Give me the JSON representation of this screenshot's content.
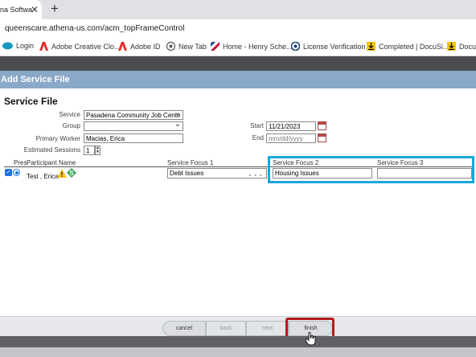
{
  "browser": {
    "tab_title": "na Softwa",
    "url": "queenscare.athena-us.com/acm_topFrameControl",
    "bookmarks": [
      {
        "label": "Login",
        "icon": "salesforce-icon",
        "color": "#1798c1"
      },
      {
        "label": "Adobe Creative Clo...",
        "icon": "adobe-icon",
        "color": "#e22b26"
      },
      {
        "label": "Adobe ID",
        "icon": "adobe-icon",
        "color": "#e22b26"
      },
      {
        "label": "New Tab",
        "icon": "globe-icon",
        "color": "#555555"
      },
      {
        "label": "Home - Henry Sche...",
        "icon": "henry-schein-icon",
        "color": "#c8102e"
      },
      {
        "label": "License Verification",
        "icon": "license-icon",
        "color": "#1a3b7a"
      },
      {
        "label": "Completed | DocuSi...",
        "icon": "docusign-icon",
        "color": "#f6c700"
      },
      {
        "label": "DocuSi",
        "icon": "docusign-icon",
        "color": "#f6c700"
      }
    ]
  },
  "dialog": {
    "window_title": "Add Service File",
    "heading": "Service File",
    "form": {
      "service_label": "Service",
      "service_value": "Pasadena Community Job Cente",
      "group_label": "Group",
      "group_value": "",
      "primary_worker_label": "Primary Worker",
      "primary_worker_value": "Macias, Erica",
      "estimated_sessions_label": "Estimated Sessions",
      "estimated_sessions_value": "1",
      "start_label": "Start",
      "start_value": "11/21/2023",
      "end_label": "End",
      "end_placeholder": "mm/dd/yyyy"
    },
    "table": {
      "headers": [
        "Pres",
        "Participant Name",
        "Service Focus 1",
        "Service Focus 2",
        "Service Focus 3"
      ],
      "rows": [
        {
          "participant": "Test , Erica",
          "focus1": "Debt Issues",
          "focus2": "Housing Issues",
          "focus3": ""
        }
      ]
    },
    "highlight_color": "#1aa7dd",
    "buttons": {
      "cancel": "cancel",
      "back": "back",
      "next": "next",
      "finish": "finish"
    },
    "finish_highlight_color": "#b31b1b"
  }
}
